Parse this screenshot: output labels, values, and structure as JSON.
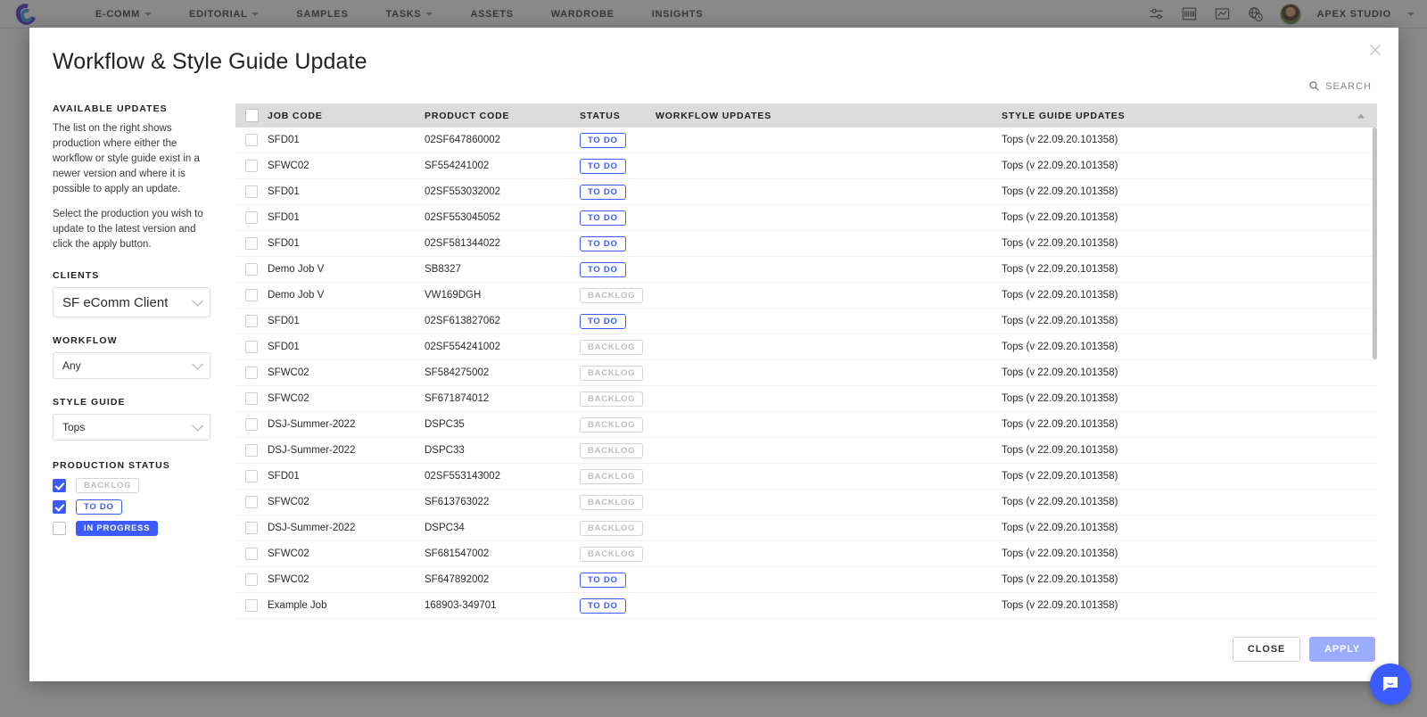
{
  "topnav": {
    "logo_name": "creative-force-logo",
    "items": [
      {
        "label": "E-COMM",
        "has_caret": true
      },
      {
        "label": "EDITORIAL",
        "has_caret": true
      },
      {
        "label": "SAMPLES",
        "has_caret": false
      },
      {
        "label": "TASKS",
        "has_caret": true
      },
      {
        "label": "ASSETS",
        "has_caret": false
      },
      {
        "label": "WARDROBE",
        "has_caret": false
      },
      {
        "label": "INSIGHTS",
        "has_caret": false
      }
    ],
    "icons": [
      "sliders-icon",
      "barcode-icon",
      "chart-icon",
      "globe-clock-icon"
    ],
    "account_label": "APEX STUDIO"
  },
  "modal": {
    "title": "Workflow & Style Guide Update",
    "close_label": "close-icon",
    "search_label": "SEARCH"
  },
  "sidebar": {
    "available_updates_heading": "AVAILABLE UPDATES",
    "paragraph_1": "The list on the right shows production where either the workflow or style guide exist in a newer version and where it is possible to apply an update.",
    "paragraph_2": "Select the production you wish to update to the latest version and click the apply button.",
    "clients_heading": "CLIENTS",
    "clients_value": "SF eComm Client",
    "workflow_heading": "WORKFLOW",
    "workflow_value": "Any",
    "style_guide_heading": "STYLE GUIDE",
    "style_guide_value": "Tops",
    "production_status_heading": "PRODUCTION STATUS",
    "status_filters": [
      {
        "label": "BACKLOG",
        "checked": true,
        "style": "backlog"
      },
      {
        "label": "TO DO",
        "checked": true,
        "style": "todo"
      },
      {
        "label": "IN PROGRESS",
        "checked": false,
        "style": "inprog"
      }
    ]
  },
  "table": {
    "columns": [
      "JOB CODE",
      "PRODUCT CODE",
      "STATUS",
      "WORKFLOW UPDATES",
      "STYLE GUIDE UPDATES"
    ],
    "sort_indicator": "ascending",
    "rows": [
      {
        "job_code": "SFD01",
        "product_code": "02SF647860002",
        "status": "TO DO",
        "status_style": "todo",
        "workflow_update": "",
        "style_guide_update": "Tops (v 22.09.20.101358)"
      },
      {
        "job_code": "SFWC02",
        "product_code": "SF554241002",
        "status": "TO DO",
        "status_style": "todo",
        "workflow_update": "",
        "style_guide_update": "Tops (v 22.09.20.101358)"
      },
      {
        "job_code": "SFD01",
        "product_code": "02SF553032002",
        "status": "TO DO",
        "status_style": "todo",
        "workflow_update": "",
        "style_guide_update": "Tops (v 22.09.20.101358)"
      },
      {
        "job_code": "SFD01",
        "product_code": "02SF553045052",
        "status": "TO DO",
        "status_style": "todo",
        "workflow_update": "",
        "style_guide_update": "Tops (v 22.09.20.101358)"
      },
      {
        "job_code": "SFD01",
        "product_code": "02SF581344022",
        "status": "TO DO",
        "status_style": "todo",
        "workflow_update": "",
        "style_guide_update": "Tops (v 22.09.20.101358)"
      },
      {
        "job_code": "Demo Job V",
        "product_code": "SB8327",
        "status": "TO DO",
        "status_style": "todo",
        "workflow_update": "",
        "style_guide_update": "Tops (v 22.09.20.101358)"
      },
      {
        "job_code": "Demo Job V",
        "product_code": "VW169DGH",
        "status": "BACKLOG",
        "status_style": "backlog",
        "workflow_update": "",
        "style_guide_update": "Tops (v 22.09.20.101358)"
      },
      {
        "job_code": "SFD01",
        "product_code": "02SF613827062",
        "status": "TO DO",
        "status_style": "todo",
        "workflow_update": "",
        "style_guide_update": "Tops (v 22.09.20.101358)"
      },
      {
        "job_code": "SFD01",
        "product_code": "02SF554241002",
        "status": "BACKLOG",
        "status_style": "backlog",
        "workflow_update": "",
        "style_guide_update": "Tops (v 22.09.20.101358)"
      },
      {
        "job_code": "SFWC02",
        "product_code": "SF584275002",
        "status": "BACKLOG",
        "status_style": "backlog",
        "workflow_update": "",
        "style_guide_update": "Tops (v 22.09.20.101358)"
      },
      {
        "job_code": "SFWC02",
        "product_code": "SF671874012",
        "status": "BACKLOG",
        "status_style": "backlog",
        "workflow_update": "",
        "style_guide_update": "Tops (v 22.09.20.101358)"
      },
      {
        "job_code": "DSJ-Summer-2022",
        "product_code": "DSPC35",
        "status": "BACKLOG",
        "status_style": "backlog",
        "workflow_update": "",
        "style_guide_update": "Tops (v 22.09.20.101358)"
      },
      {
        "job_code": "DSJ-Summer-2022",
        "product_code": "DSPC33",
        "status": "BACKLOG",
        "status_style": "backlog",
        "workflow_update": "",
        "style_guide_update": "Tops (v 22.09.20.101358)"
      },
      {
        "job_code": "SFD01",
        "product_code": "02SF553143002",
        "status": "BACKLOG",
        "status_style": "backlog",
        "workflow_update": "",
        "style_guide_update": "Tops (v 22.09.20.101358)"
      },
      {
        "job_code": "SFWC02",
        "product_code": "SF613763022",
        "status": "BACKLOG",
        "status_style": "backlog",
        "workflow_update": "",
        "style_guide_update": "Tops (v 22.09.20.101358)"
      },
      {
        "job_code": "DSJ-Summer-2022",
        "product_code": "DSPC34",
        "status": "BACKLOG",
        "status_style": "backlog",
        "workflow_update": "",
        "style_guide_update": "Tops (v 22.09.20.101358)"
      },
      {
        "job_code": "SFWC02",
        "product_code": "SF681547002",
        "status": "BACKLOG",
        "status_style": "backlog",
        "workflow_update": "",
        "style_guide_update": "Tops (v 22.09.20.101358)"
      },
      {
        "job_code": "SFWC02",
        "product_code": "SF647892002",
        "status": "TO DO",
        "status_style": "todo",
        "workflow_update": "",
        "style_guide_update": "Tops (v 22.09.20.101358)"
      },
      {
        "job_code": "Example Job",
        "product_code": "168903-349701",
        "status": "TO DO",
        "status_style": "todo",
        "workflow_update": "",
        "style_guide_update": "Tops (v 22.09.20.101358)"
      }
    ]
  },
  "footer": {
    "close_label": "CLOSE",
    "apply_label": "APPLY"
  },
  "chat": {
    "name": "chat-bubble-icon"
  },
  "colors": {
    "accent_blue": "#3b5bfd",
    "apply_disabled": "#9aacfb",
    "header_gray": "#dcdcdc",
    "backlog_gray": "#bdbdbd"
  }
}
